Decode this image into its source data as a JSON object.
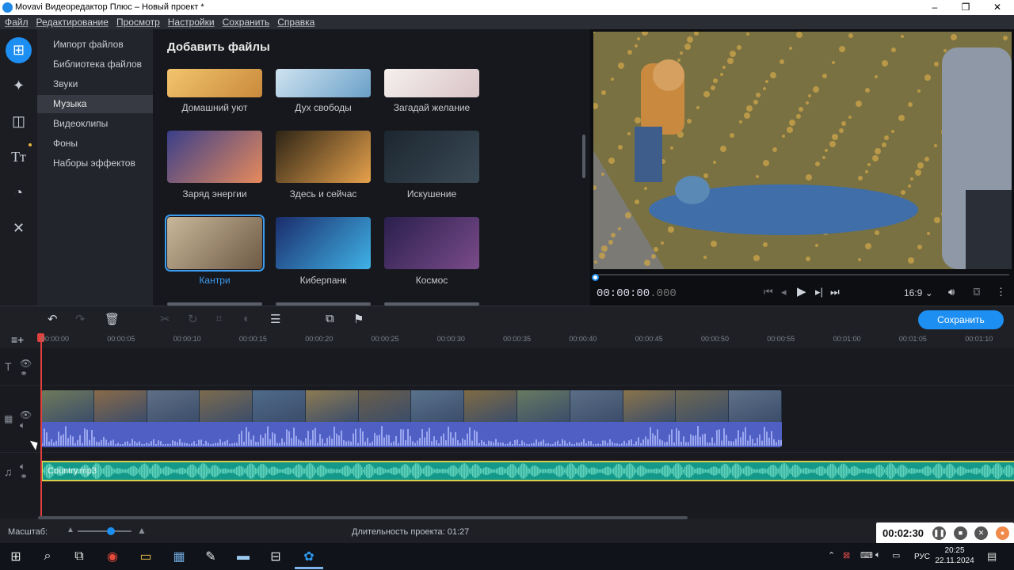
{
  "window": {
    "title": "Movavi Видеоредактор Плюс – Новый проект *",
    "min": "–",
    "max": "❐",
    "close": "✕"
  },
  "menu": [
    "Файл",
    "Редактирование",
    "Просмотр",
    "Настройки",
    "Сохранить",
    "Справка"
  ],
  "rail": [
    "import-icon",
    "magic-wand-icon",
    "transitions-icon",
    "titles-icon",
    "filters-icon",
    "tools-icon"
  ],
  "categories": [
    "Импорт файлов",
    "Библиотека файлов",
    "Звуки",
    "Музыка",
    "Видеоклипы",
    "Фоны",
    "Наборы эффектов"
  ],
  "selected_category": "Музыка",
  "library": {
    "heading": "Добавить файлы",
    "tiles": [
      {
        "label": "Домашний уют",
        "colors": [
          "#f2c46d",
          "#c98a3c"
        ]
      },
      {
        "label": "Дух свободы",
        "colors": [
          "#cfe3f0",
          "#6aa0c8"
        ]
      },
      {
        "label": "Загадай желание",
        "colors": [
          "#f5f0ee",
          "#d9c3c7"
        ]
      },
      {
        "label": "Заряд энергии",
        "colors": [
          "#3a3f8a",
          "#e68a5c"
        ]
      },
      {
        "label": "Здесь и сейчас",
        "colors": [
          "#2d2416",
          "#e7a24c"
        ]
      },
      {
        "label": "Искушение",
        "colors": [
          "#1c2630",
          "#3a4a55"
        ]
      },
      {
        "label": "Кантри",
        "colors": [
          "#c9b79a",
          "#6e5a45"
        ],
        "selected": true
      },
      {
        "label": "Киберпанк",
        "colors": [
          "#1b2c6b",
          "#3fb2e6"
        ]
      },
      {
        "label": "Космос",
        "colors": [
          "#2a1f4d",
          "#7a4b8a"
        ]
      }
    ]
  },
  "preview": {
    "timecode_main": "00:00:00",
    "timecode_ms": ".000",
    "aspect": "16:9 ⌄"
  },
  "timeline": {
    "save_label": "Сохранить",
    "ticks": [
      "00:00:00",
      "00:00:05",
      "00:00:10",
      "00:00:15",
      "00:00:20",
      "00:00:25",
      "00:00:30",
      "00:00:35",
      "00:00:40",
      "00:00:45",
      "00:00:50",
      "00:00:55",
      "00:01:00",
      "00:01:05",
      "00:01:10"
    ],
    "audio_clip": "Country.mp3"
  },
  "status": {
    "zoom_label": "Масштаб:",
    "duration": "Длительность проекта: 01:27"
  },
  "recorder": {
    "time": "00:02:30"
  },
  "taskbar": {
    "lang": "РУС",
    "time": "20:25",
    "date": "22.11.2024"
  }
}
